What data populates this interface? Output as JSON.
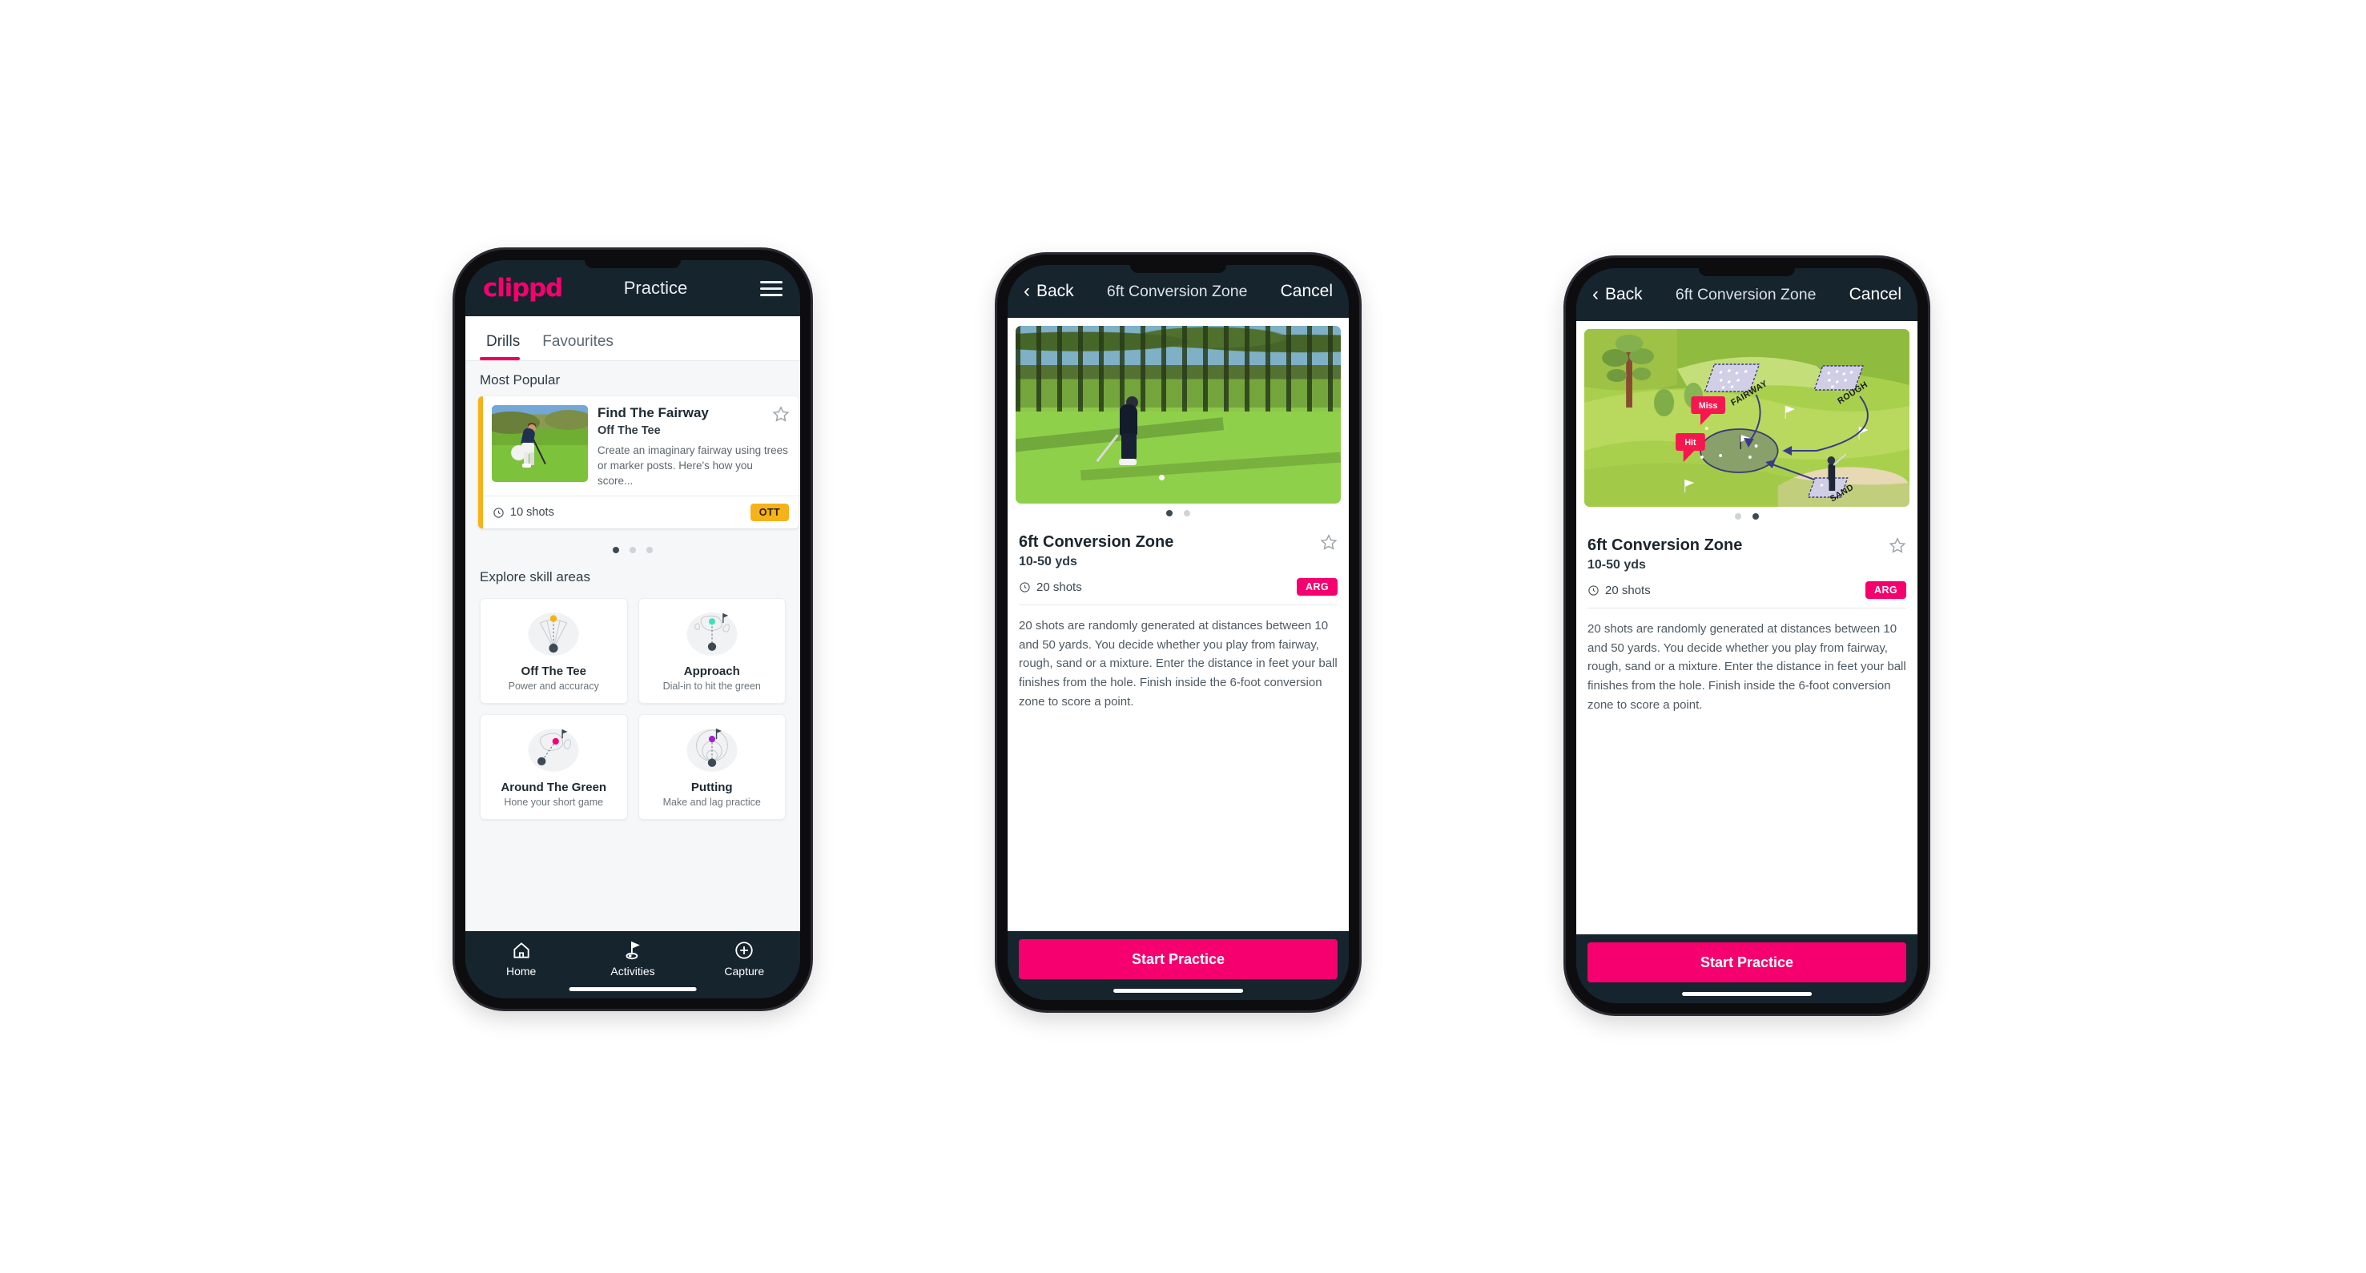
{
  "phone1": {
    "header": {
      "logo": "clippd",
      "title": "Practice",
      "menu_icon": "hamburger-icon"
    },
    "tabs": [
      {
        "label": "Drills",
        "active": true
      },
      {
        "label": "Favourites",
        "active": false
      }
    ],
    "sections": {
      "most_popular": "Most Popular",
      "explore": "Explore skill areas"
    },
    "drill_card": {
      "title": "Find The Fairway",
      "subtitle": "Off The Tee",
      "description": "Create an imaginary fairway using trees or marker posts. Here's how you score...",
      "shots": "10 shots",
      "badge": "OTT",
      "badge_color": "#f5b21a",
      "accent_color": "#f5b21a",
      "star_icon": "star-outline-icon",
      "clock_icon": "clock-icon"
    },
    "peek_card_color": "#3fe0b8",
    "carousel_dots": {
      "count": 3,
      "active_index": 0
    },
    "skill_areas": [
      {
        "name": "Off The Tee",
        "desc": "Power and accuracy",
        "icon": "tee-fan-icon",
        "dot_color": "#f5b21a"
      },
      {
        "name": "Approach",
        "desc": "Dial-in to hit the green",
        "icon": "green-approach-icon",
        "dot_color": "#3fe0b8"
      },
      {
        "name": "Around The Green",
        "desc": "Hone your short game",
        "icon": "chip-icon",
        "dot_color": "#f5006e"
      },
      {
        "name": "Putting",
        "desc": "Make and lag practice",
        "icon": "putt-rings-icon",
        "dot_color": "#a020d0"
      }
    ],
    "bottom_nav": [
      {
        "label": "Home",
        "icon": "home-icon",
        "active": false
      },
      {
        "label": "Activities",
        "icon": "golf-flag-icon",
        "active": true
      },
      {
        "label": "Capture",
        "icon": "plus-circle-icon",
        "active": false
      }
    ]
  },
  "detail": {
    "header": {
      "back": "Back",
      "title": "6ft Conversion Zone",
      "cancel": "Cancel",
      "back_icon": "chevron-left-icon"
    },
    "name": "6ft Conversion Zone",
    "yards": "10-50 yds",
    "shots": "20 shots",
    "badge": "ARG",
    "badge_color": "#f5006e",
    "star_icon": "star-outline-icon",
    "clock_icon": "clock-icon",
    "description": "20 shots are randomly generated at distances between 10 and 50 yards. You decide whether you play from fairway, rough, sand or a mixture. Enter the distance in feet your ball finishes from the hole. Finish inside the 6-foot conversion zone to score a point.",
    "cta": "Start Practice"
  },
  "phone2": {
    "media_kind": "photo",
    "carousel_dots": {
      "count": 2,
      "active_index": 0
    }
  },
  "phone3": {
    "media_kind": "course-diagram",
    "carousel_dots": {
      "count": 2,
      "active_index": 1
    },
    "diagram_labels": {
      "fairway": "FAIRWAY",
      "rough": "ROUGH",
      "sand": "SAND",
      "miss": "Miss",
      "hit": "Hit"
    }
  },
  "colors": {
    "brand_pink": "#f5006e",
    "dark_navy": "#16242e",
    "amber": "#f5b21a",
    "teal": "#3fe0b8"
  }
}
